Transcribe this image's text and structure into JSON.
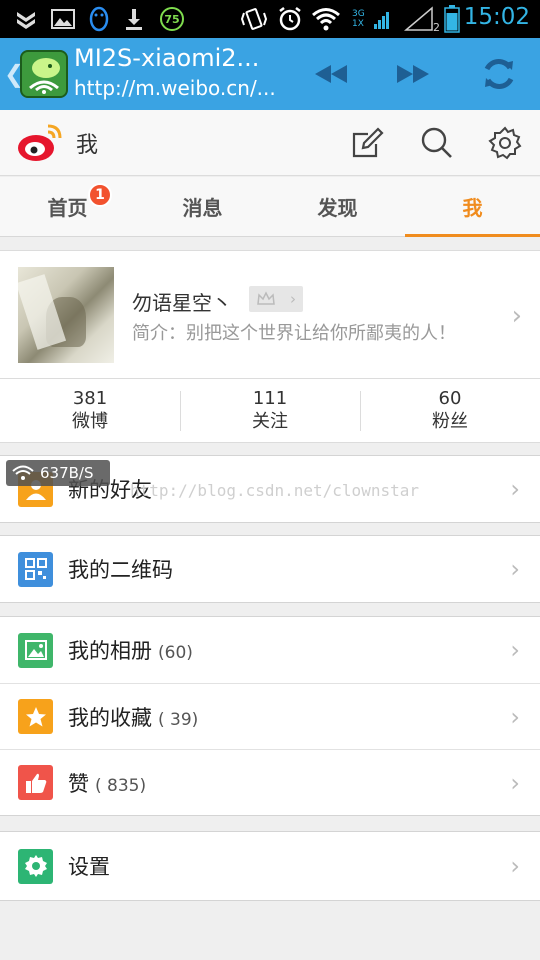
{
  "status_bar": {
    "time": "15:02",
    "battery_badge": "75",
    "network_label": "3G",
    "network_sub": "1X",
    "sim_count": "2",
    "icons": [
      "app-shield-icon",
      "image-icon",
      "qq-penguin-icon",
      "download-icon",
      "battery-circle-icon",
      "vibrate-icon",
      "alarm-icon",
      "wifi-icon",
      "signal-icon",
      "sim-signal-icon",
      "battery-icon"
    ]
  },
  "browser": {
    "title": "MI2S-xiaomi2...",
    "url": "http://m.weibo.cn/...",
    "favicon": "android-wifi-favicon"
  },
  "app_header": {
    "title": "我"
  },
  "tabs": [
    {
      "label": "首页",
      "badge": "1",
      "active": false
    },
    {
      "label": "消息",
      "active": false
    },
    {
      "label": "发现",
      "active": false
    },
    {
      "label": "我",
      "active": true
    }
  ],
  "profile": {
    "name": "勿语星空丶",
    "bio": "简介：别把这个世界让给你所鄙夷的人！",
    "stats": [
      {
        "value": "381",
        "label": "微博"
      },
      {
        "value": "111",
        "label": "关注"
      },
      {
        "value": "60",
        "label": "粉丝"
      }
    ]
  },
  "menu": {
    "new_friends": {
      "label": "新的好友"
    },
    "qr_code": {
      "label": "我的二维码"
    },
    "album": {
      "label": "我的相册",
      "count": "(60)"
    },
    "favorites": {
      "label": "我的收藏",
      "count": "( 39)"
    },
    "likes": {
      "label": "赞",
      "count": "( 835)"
    },
    "settings": {
      "label": "设置"
    }
  },
  "overlay": {
    "watermark": "http://blog.csdn.net/clownstar",
    "speed": "637B/S"
  },
  "colors": {
    "browser_bar": "#3aa3e3",
    "accent": "#f08c1e",
    "badge_red": "#f2522e",
    "icon_orange": "#f7a21b",
    "icon_blue": "#3f8fdc",
    "icon_green": "#3fb66a",
    "icon_red": "#f0544a",
    "icon_teal": "#2db574"
  }
}
